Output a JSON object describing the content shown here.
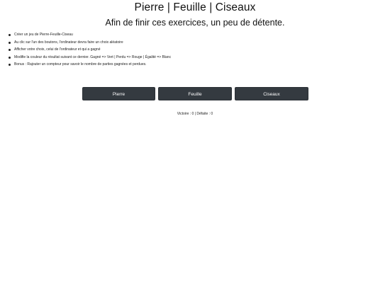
{
  "header": {
    "title": "Pierre | Feuille | Ciseaux",
    "subtitle": "Afin de finir ces exercices, un peu de détente."
  },
  "instructions": {
    "items": [
      "Créer un jeu de Pierre-Feuille-Ciseau",
      "Au clic sur l'un des boutons, l'ordinateur devra faire un choix aléatoire",
      "Afficher votre choix, celui de l'ordinateur et qui a gagné",
      "Modifie la couleur du résultat suivant ce dernier. Gagné => Vert | Perdu => Rouge | Égalité => Blanc",
      "Bonus : Rajouter un compteur pour savoir le nombre de parties gagnées et perdues."
    ]
  },
  "buttons": {
    "rock_label": "Pierre",
    "paper_label": "Feuille",
    "scissors_label": "Ciseaux"
  },
  "score": {
    "text": "Victoire : 0 | Défaite : 0"
  },
  "colors": {
    "button_bg": "#343a40",
    "button_text": "#ffffff",
    "page_bg": "#ffffff"
  }
}
